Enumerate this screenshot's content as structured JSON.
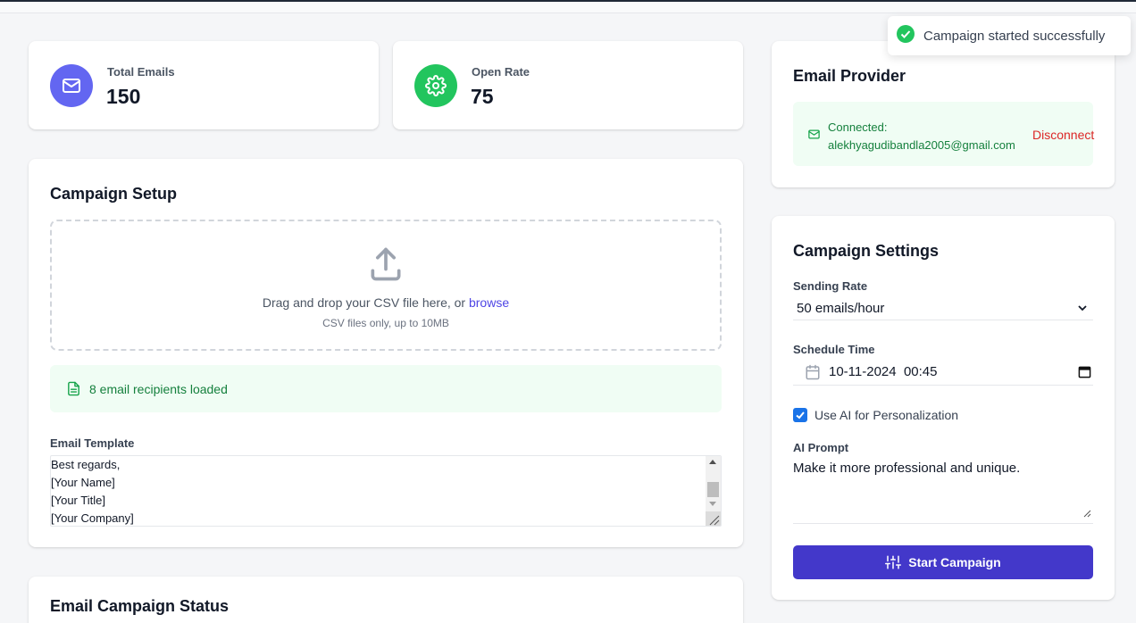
{
  "stats": {
    "total_emails": {
      "label": "Total Emails",
      "value": "150",
      "icon": "mail-icon",
      "color": "#6366f1"
    },
    "open_rate": {
      "label": "Open Rate",
      "value": "75",
      "icon": "gear-icon",
      "color": "#22c55e"
    }
  },
  "campaign_setup": {
    "title": "Campaign Setup",
    "drop_text": "Drag and drop your CSV file here, or ",
    "browse_label": "browse",
    "drop_subtext": "CSV files only, up to 10MB",
    "recipients_loaded": "8 email recipients loaded",
    "template_label": "Email Template",
    "template_lines": [
      "Best regards,",
      "[Your Name]",
      "[Your Title]",
      "[Your Company]"
    ]
  },
  "campaign_status": {
    "title": "Email Campaign Status"
  },
  "email_provider": {
    "title": "Email Provider",
    "connected_label": "Connected:",
    "email": "alekhyagudibandla2005@gmail.com",
    "disconnect_label": "Disconnect"
  },
  "campaign_settings": {
    "title": "Campaign Settings",
    "sending_rate_label": "Sending Rate",
    "sending_rate_value": "50 emails/hour",
    "schedule_label": "Schedule Time",
    "schedule_value": "10-11-2024  00:45",
    "use_ai_label": "Use AI for Personalization",
    "use_ai_checked": true,
    "ai_prompt_label": "AI Prompt",
    "ai_prompt_value": "Make it more professional and unique.",
    "start_button": "Start Campaign"
  },
  "toast": {
    "message": "Campaign started successfully",
    "color": "#22c55e"
  },
  "colors": {
    "accent": "#4338ca",
    "success_bg": "#f0fdf4",
    "success_text": "#15803d",
    "danger": "#dc2626"
  }
}
